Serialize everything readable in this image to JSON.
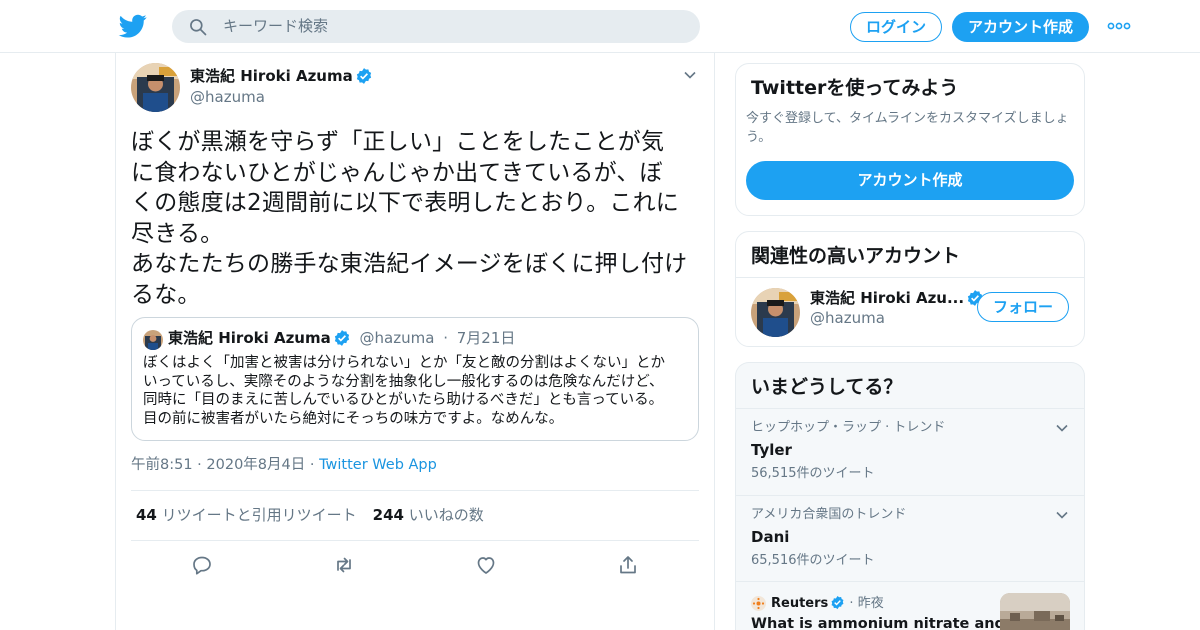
{
  "colors": {
    "brand": "#1da1f2",
    "link": "#1b95e0",
    "text": "#14171a",
    "muted": "#657786",
    "border": "#e6ecf0",
    "panel": "#f5f8fa"
  },
  "header": {
    "logo_icon": "twitter-bird-icon",
    "search_placeholder": "キーワード検索",
    "login_label": "ログイン",
    "signup_label": "アカウント作成",
    "more_icon": "more-dots-icon"
  },
  "tweet": {
    "author_name": "東浩紀 Hiroki Azuma",
    "author_handle": "@hazuma",
    "text": "ぼくが黒瀬を守らず「正しい」ことをしたことが気\nに食わないひとがじゃんじゃか出てきているが、ぼ\nくの態度は2週間前に以下で表明したとおり。これに\n尽きる。\nあなたたちの勝手な東浩紀イメージをぼくに押し付け\nるな。",
    "quoted": {
      "author_name": "東浩紀 Hiroki Azuma",
      "author_handle": "@hazuma",
      "separator": "·",
      "date": "7月21日",
      "text": "ぼくはよく「加害と被害は分けられない」とか「友と敵の分割はよくない」とか\nいっているし、実際そのような分割を抽象化し一般化するのは危険なんだけど、\n同時に「目のまえに苦しんでいるひとがいたら助けるべきだ」とも言っている。\n目の前に被害者がいたら絶対にそっちの味方ですよ。なめんな。"
    },
    "time": "午前8:51",
    "date": "2020年8月4日",
    "separator": "·",
    "source": "Twitter Web App",
    "retweet_count": "44",
    "retweet_label": "リツイートと引用リツイート",
    "like_count": "244",
    "like_label": "いいねの数"
  },
  "sidebar": {
    "try_card": {
      "title": "Twitterを使ってみよう",
      "subtitle": "今すぐ登録して、タイムラインをカスタマイズしましょう。",
      "signup_label": "アカウント作成"
    },
    "related": {
      "title": "関連性の高いアカウント",
      "account_name": "東浩紀 Hiroki Azu...",
      "account_handle": "@hazuma",
      "follow_label": "フォロー"
    },
    "trends": {
      "title": "いまどうしてる？",
      "items": [
        {
          "context": "ヒップホップ・ラップ · トレンド",
          "name": "Tyler",
          "count": "56,515件のツイート"
        },
        {
          "context": "アメリカ合衆国のトレンド",
          "name": "Dani",
          "count": "65,516件のツイート"
        }
      ],
      "news": {
        "source": "Reuters",
        "separator": "·",
        "time": "昨夜",
        "headline": "What is ammonium nitrate and why"
      }
    }
  }
}
